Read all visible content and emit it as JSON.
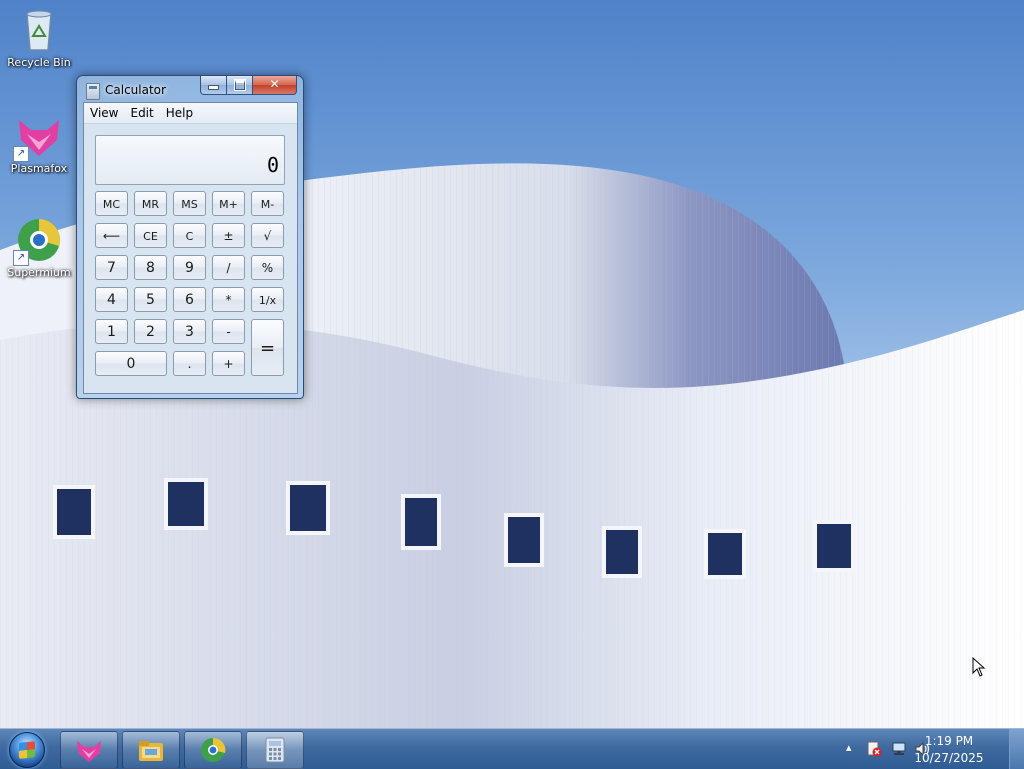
{
  "desktop": {
    "icons": [
      {
        "label": "Recycle Bin",
        "icon": "recycle-bin-icon"
      },
      {
        "label": "Plasmafox",
        "icon": "plasmafox-icon"
      },
      {
        "label": "Supermium",
        "icon": "supermium-icon"
      }
    ]
  },
  "calculator": {
    "title": "Calculator",
    "menu": [
      "View",
      "Edit",
      "Help"
    ],
    "display_value": "0",
    "keys": {
      "mc": "MC",
      "mr": "MR",
      "ms": "MS",
      "mplus": "M+",
      "mminus": "M-",
      "backspace": "⟵",
      "ce": "CE",
      "c": "C",
      "plusminus": "±",
      "sqrt": "√",
      "seven": "7",
      "eight": "8",
      "nine": "9",
      "divide": "/",
      "percent": "%",
      "four": "4",
      "five": "5",
      "six": "6",
      "multiply": "*",
      "reciprocal": "1/x",
      "one": "1",
      "two": "2",
      "three": "3",
      "minus": "-",
      "equals": "=",
      "zero": "0",
      "decimal": ".",
      "plus": "+"
    },
    "caption": {
      "close": "✕"
    }
  },
  "taskbar": {
    "buttons": [
      "plasmafox-icon",
      "file-explorer-icon",
      "supermium-icon",
      "calculator-icon"
    ],
    "active": "calculator-icon",
    "clock_time": "1:19 PM",
    "clock_date": "10/27/2025",
    "tray_arrow": "▴"
  },
  "colors": {
    "taskbar": "#3e6aa0",
    "window_frame": "#a9c8ea",
    "close_button": "#c2412a"
  }
}
